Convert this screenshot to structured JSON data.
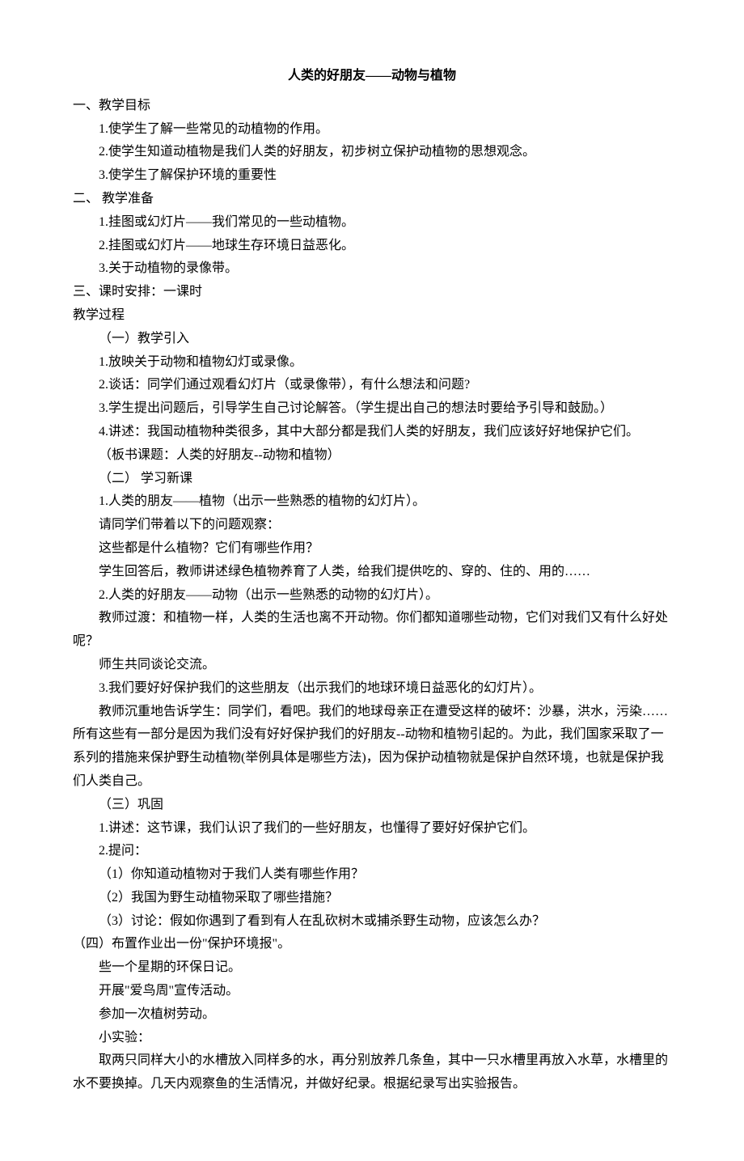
{
  "title": "人类的好朋友——动物与植物",
  "sections": {
    "s1": {
      "heading": "一、教学目标",
      "items": {
        "i1": "1.使学生了解一些常见的动植物的作用。",
        "i2": "2.使学生知道动植物是我们人类的好朋友，初步树立保护动植物的思想观念。",
        "i3": "3.使学生了解保护环境的重要性"
      }
    },
    "s2": {
      "heading": "二、 教学准备",
      "items": {
        "i1": "1.挂图或幻灯片——我们常见的一些动植物。",
        "i2": "2.挂图或幻灯片——地球生存环境日益恶化。",
        "i3": "3.关于动植物的录像带。"
      }
    },
    "s3": {
      "heading": "三、课时安排：一课时"
    },
    "process": {
      "heading": "教学过程",
      "sub1": {
        "title": "（一）教学引入",
        "i1": "1.放映关于动物和植物幻灯或录像。",
        "i2": "2.谈话：同学们通过观看幻灯片（或录像带），有什么想法和问题?",
        "i3": "3.学生提出问题后，引导学生自己讨论解答。（学生提出自己的想法时要给予引导和鼓励。）",
        "i4": "4.讲述：我国动植物种类很多，其中大部分都是我们人类的好朋友，我们应该好好地保护它们。",
        "i5": "（板书课题：人类的好朋友--动物和植物）"
      },
      "sub2": {
        "title": "（二） 学习新课",
        "p1": "1.人类的朋友——植物（出示一些熟悉的植物的幻灯片）。",
        "p2": "请同学们带着以下的问题观察：",
        "p3": "这些都是什么植物？它们有哪些作用？",
        "p4": "学生回答后，教师讲述绿色植物养育了人类，给我们提供吃的、穿的、住的、用的……",
        "p5": "2.人类的好朋友——动物（出示一些熟悉的动物的幻灯片）。",
        "p6": "教师过渡：和植物一样，人类的生活也离不开动物。你们都知道哪些动物，它们对我们又有什么好处呢？",
        "p7": "师生共同谈论交流。",
        "p8": "3.我们要好好保护我们的这些朋友（出示我们的地球环境日益恶化的幻灯片）。",
        "p9": "教师沉重地告诉学生：同学们，看吧。我们的地球母亲正在遭受这样的破坏：沙暴，洪水，污染……所有这些有一部分是因为我们没有好好保护我们的好朋友--动物和植物引起的。为此，我们国家采取了一系列的措施来保护野生动植物(举例具体是哪些方法)，因为保护动植物就是保护自然环境，也就是保护我们人类自己。"
      },
      "sub3": {
        "title": "（三）巩固",
        "p1": "1.讲述：这节课，我们认识了我们的一些好朋友，也懂得了要好好保护它们。",
        "p2": "2.提问：",
        "q1": "（1）你知道动植物对于我们人类有哪些作用？",
        "q2": "（2）我国为野生动植物采取了哪些措施？",
        "q3": "（3）讨论：假如你遇到了看到有人在乱砍树木或捕杀野生动物，应该怎么办？"
      },
      "sub4": {
        "title": "（四）布置作业出一份\"保护环境报\"。",
        "p1": "些一个星期的环保日记。",
        "p2": "开展\"爱鸟周\"宣传活动。",
        "p3": "参加一次植树劳动。",
        "p4": "小实验：",
        "p5": "取两只同样大小的水槽放入同样多的水，再分别放养几条鱼，其中一只水槽里再放入水草，水槽里的水不要换掉。几天内观察鱼的生活情况，并做好纪录。根据纪录写出实验报告。"
      }
    }
  }
}
